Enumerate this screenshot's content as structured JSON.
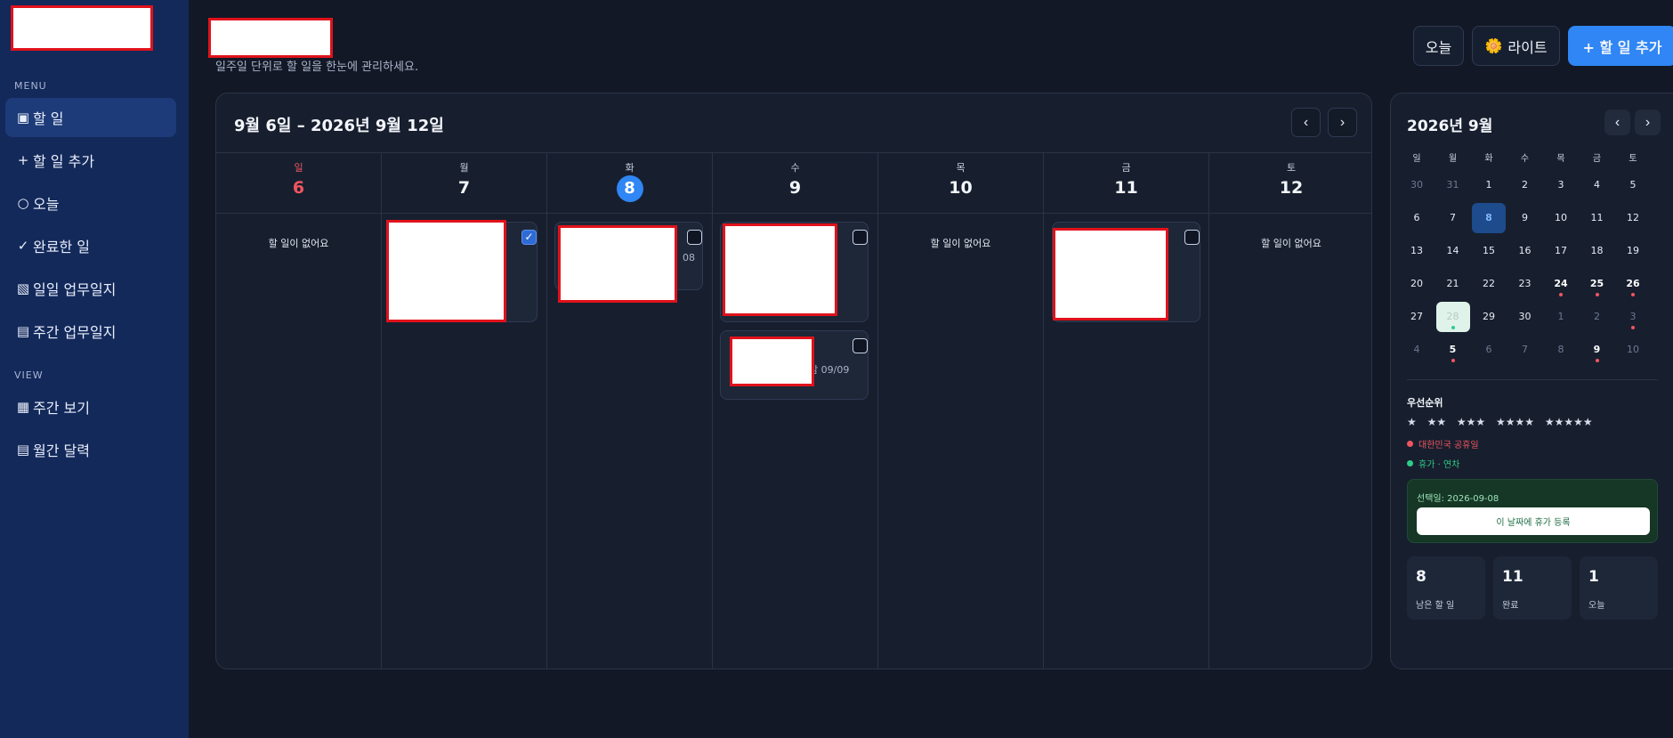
{
  "sidebar": {
    "menu_label": "MENU",
    "view_label": "VIEW",
    "items": [
      {
        "icon": "▣",
        "label": "할 일"
      },
      {
        "icon": "+",
        "label": "할 일 추가"
      },
      {
        "icon": "○",
        "label": "오늘"
      },
      {
        "icon": "✓",
        "label": "완료한 일"
      },
      {
        "icon": "▧",
        "label": "일일 업무일지"
      },
      {
        "icon": "▤",
        "label": "주간 업무일지"
      }
    ],
    "view_items": [
      {
        "icon": "▦",
        "label": "주간 보기"
      },
      {
        "icon": "▤",
        "label": "월간 달력"
      }
    ]
  },
  "header": {
    "subtitle": "일주일 단위로 할 일을 한눈에 관리하세요.",
    "today_btn": "오늘",
    "theme_icon": "🌼",
    "theme_btn": "라이트",
    "add_btn": "+ 할 일 추가"
  },
  "week": {
    "title": "9월 6일 – 2026년 9월 12일",
    "prev": "‹",
    "next": "›",
    "empty_text": "할 일이 없어요",
    "days": [
      {
        "name": "일",
        "num": "6"
      },
      {
        "name": "월",
        "num": "7"
      },
      {
        "name": "화",
        "num": "8"
      },
      {
        "name": "수",
        "num": "9"
      },
      {
        "name": "목",
        "num": "10"
      },
      {
        "name": "금",
        "num": "11"
      },
      {
        "name": "토",
        "num": "12"
      }
    ],
    "task_meta_tue": "08",
    "task_meta_wed": "감 09/09",
    "check_mark": "✓"
  },
  "mini_calendar": {
    "title": "2026년 9월",
    "prev": "‹",
    "next": "›",
    "weekdays": [
      "일",
      "월",
      "화",
      "수",
      "목",
      "금",
      "토"
    ],
    "rows": [
      [
        "30",
        "31",
        "1",
        "2",
        "3",
        "4",
        "5"
      ],
      [
        "6",
        "7",
        "8",
        "9",
        "10",
        "11",
        "12"
      ],
      [
        "13",
        "14",
        "15",
        "16",
        "17",
        "18",
        "19"
      ],
      [
        "20",
        "21",
        "22",
        "23",
        "24",
        "25",
        "26"
      ],
      [
        "27",
        "28",
        "29",
        "30",
        "1",
        "2",
        "3"
      ],
      [
        "4",
        "5",
        "6",
        "7",
        "8",
        "9",
        "10"
      ]
    ]
  },
  "priority": {
    "title": "우선순위",
    "stars": "★ ★★ ★★★ ★★★★ ★★★★★"
  },
  "legend": {
    "holiday": "대한민국 공휴일",
    "vacation": "휴가 · 연차",
    "holiday_color": "#f0555f",
    "vacation_color": "#2ecc8a"
  },
  "selected": {
    "label": "선택일: 2026-09-08",
    "button": "이 날짜에 휴가 등록"
  },
  "stats": [
    {
      "num": "8",
      "label": "남은 할 일"
    },
    {
      "num": "11",
      "label": "완료"
    },
    {
      "num": "1",
      "label": "오늘"
    }
  ]
}
